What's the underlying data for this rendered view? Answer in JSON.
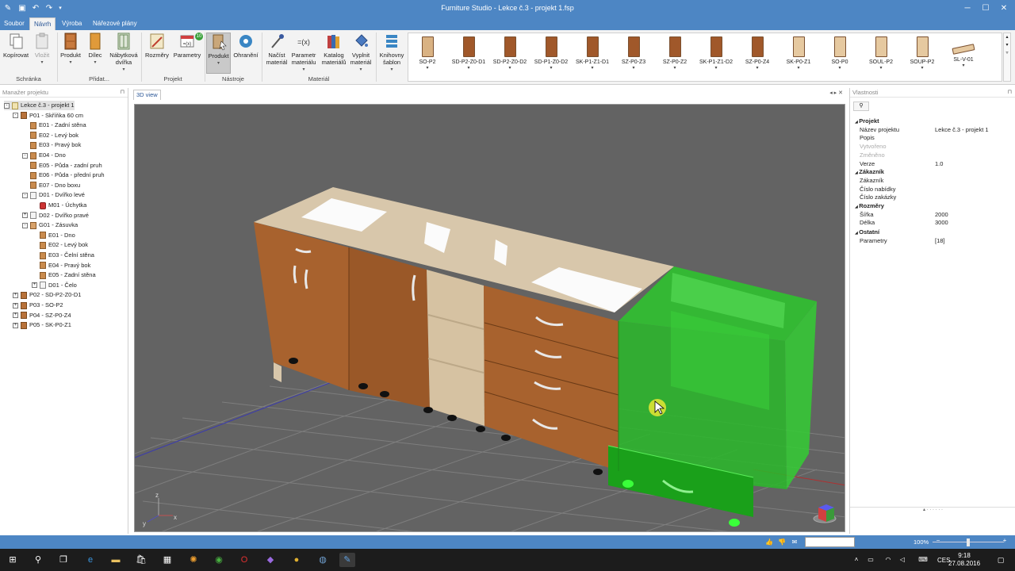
{
  "window": {
    "title": "Furniture Studio - Lekce č.3 - projekt 1.fsp"
  },
  "menu_tabs": [
    "Soubor",
    "Návrh",
    "Výroba",
    "Nářezové plány"
  ],
  "ribbon": {
    "buttons": {
      "kopirovat": "Kopírovat",
      "vlozit": "Vložit",
      "produkt": "Produkt",
      "dilec": "Dílec",
      "nabytkova_dvirka_1": "Nábytková",
      "nabytkova_dvirka_2": "dvířka",
      "rozmery": "Rozměry",
      "parametry": "Parametry",
      "produkt_tool": "Produkt",
      "ohraneni": "Ohranění",
      "nacist_material_1": "Načíst",
      "nacist_material_2": "materiál",
      "parametr_materialu_1": "Parametr",
      "parametr_materialu_2": "materiálu",
      "katalog_materialu_1": "Katalog",
      "katalog_materialu_2": "materiálů",
      "vyplnit_material_1": "Vyplnit",
      "vyplnit_material_2": "materiál",
      "knihovny_sablon_1": "Knihovny",
      "knihovny_sablon_2": "šablon"
    },
    "parametry_badge": "10",
    "groups": {
      "schranka": "Schránka",
      "pridat": "Přidat...",
      "projekt": "Projekt",
      "nastroje": "Nástroje",
      "material": "Materiál"
    },
    "gallery": [
      {
        "label": "SO-P2",
        "color": "#d9b283"
      },
      {
        "label": "SD-P2-Z0-D1",
        "color": "#a0582a"
      },
      {
        "label": "SD-P2-Z0-D2",
        "color": "#a0582a"
      },
      {
        "label": "SD-P1-Z0-D2",
        "color": "#a0582a"
      },
      {
        "label": "SK-P1-Z1-D1",
        "color": "#a0582a"
      },
      {
        "label": "SZ-P0-Z3",
        "color": "#a0582a"
      },
      {
        "label": "SZ-P0-Z2",
        "color": "#a0582a"
      },
      {
        "label": "SK-P1-Z1-D2",
        "color": "#a0582a"
      },
      {
        "label": "SZ-P0-Z4",
        "color": "#a0582a"
      },
      {
        "label": "SK-P0-Z1",
        "color": "#e6c9a0"
      },
      {
        "label": "SO-P0",
        "color": "#e6c9a0"
      },
      {
        "label": "SOUL-P2",
        "color": "#e6c9a0"
      },
      {
        "label": "SOUP-P2",
        "color": "#e6c9a0"
      },
      {
        "label": "SL-V-01",
        "color": "#e6c9a0"
      }
    ]
  },
  "project_manager": {
    "title": "Manažer projektu",
    "tree": [
      {
        "label": "Lekce č.3 - projekt 1",
        "level": 0,
        "icon": "proj",
        "exp": "-",
        "sel": true
      },
      {
        "label": "P01 - Skříňka 60 cm",
        "level": 1,
        "icon": "cab",
        "exp": "-"
      },
      {
        "label": "E01 - Zadní stěna",
        "level": 2,
        "icon": "brd"
      },
      {
        "label": "E02 - Levý bok",
        "level": 2,
        "icon": "brd"
      },
      {
        "label": "E03 - Pravý bok",
        "level": 2,
        "icon": "brd"
      },
      {
        "label": "E04 - Dno",
        "level": 2,
        "icon": "brd",
        "exp": "-"
      },
      {
        "label": "E05 - Půda - zadní pruh",
        "level": 2,
        "icon": "brd"
      },
      {
        "label": "E06 - Půda - přední pruh",
        "level": 2,
        "icon": "brd"
      },
      {
        "label": "E07 - Dno boxu",
        "level": 2,
        "icon": "brd"
      },
      {
        "label": "D01 - Dvířko levé",
        "level": 2,
        "icon": "door",
        "exp": "-"
      },
      {
        "label": "M01 - Úchytka",
        "level": 3,
        "icon": "hnd"
      },
      {
        "label": "D02 - Dvířko pravé",
        "level": 2,
        "icon": "door",
        "exp": "+"
      },
      {
        "label": "G01 - Zásuvka",
        "level": 2,
        "icon": "drw",
        "exp": "-"
      },
      {
        "label": "E01 - Dno",
        "level": 3,
        "icon": "brd"
      },
      {
        "label": "E02 - Levý bok",
        "level": 3,
        "icon": "brd"
      },
      {
        "label": "E03 - Čelní stěna",
        "level": 3,
        "icon": "brd"
      },
      {
        "label": "E04 - Pravý bok",
        "level": 3,
        "icon": "brd"
      },
      {
        "label": "E05 - Zadní stěna",
        "level": 3,
        "icon": "brd"
      },
      {
        "label": "D01 - Čelo",
        "level": 3,
        "icon": "door",
        "exp": "+"
      },
      {
        "label": "P02 - SD-P2-Z0-D1",
        "level": 1,
        "icon": "cab",
        "exp": "+"
      },
      {
        "label": "P03 - SO-P2",
        "level": 1,
        "icon": "cab",
        "exp": "+"
      },
      {
        "label": "P04 - SZ-P0-Z4",
        "level": 1,
        "icon": "cab",
        "exp": "+"
      },
      {
        "label": "P05 - SK-P0-Z1",
        "level": 1,
        "icon": "cab",
        "exp": "+"
      }
    ]
  },
  "view": {
    "tab": "3D view",
    "axis_labels": {
      "x": "x",
      "y": "y",
      "z": "z"
    }
  },
  "properties": {
    "title": "Vlastnosti",
    "sections": [
      {
        "name": "Projekt",
        "rows": [
          {
            "k": "Název projektu",
            "v": "Lekce č.3 - projekt 1"
          },
          {
            "k": "Popis",
            "v": ""
          },
          {
            "k": "Vytvořeno",
            "v": "",
            "dis": true
          },
          {
            "k": "Změněno",
            "v": "",
            "dis": true
          },
          {
            "k": "Verze",
            "v": "1.0"
          }
        ]
      },
      {
        "name": "Zákazník",
        "rows": [
          {
            "k": "Zákazník",
            "v": ""
          },
          {
            "k": "Číslo nabídky",
            "v": ""
          },
          {
            "k": "Číslo zakázky",
            "v": ""
          }
        ]
      },
      {
        "name": "Rozměry",
        "rows": [
          {
            "k": "Šířka",
            "v": "2000"
          },
          {
            "k": "Délka",
            "v": "3000"
          }
        ]
      },
      {
        "name": "Ostatní",
        "rows": [
          {
            "k": "Parametry",
            "v": "[18]"
          }
        ]
      }
    ]
  },
  "statusbar": {
    "zoom": "100%"
  },
  "taskbar": {
    "lang": "CES",
    "time": "9:18",
    "date": "27.08.2016"
  }
}
